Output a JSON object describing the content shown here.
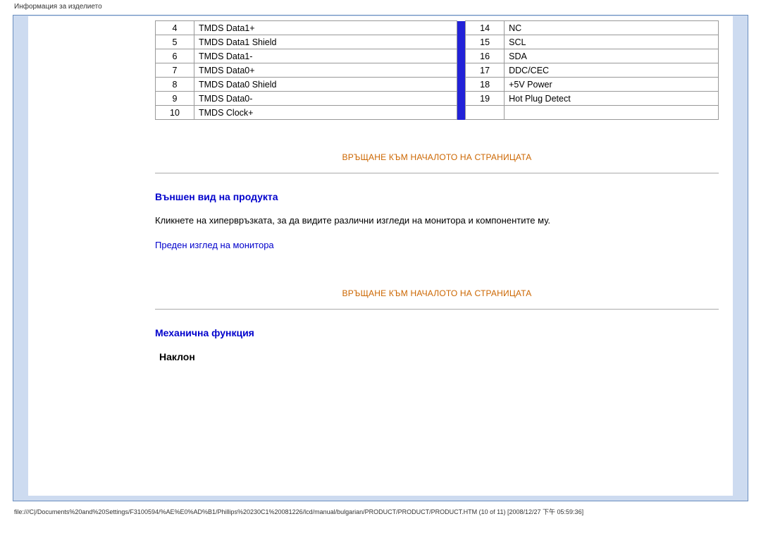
{
  "header": "Информация за изделието",
  "pin_left": [
    {
      "n": "4",
      "d": "TMDS Data1+"
    },
    {
      "n": "5",
      "d": "TMDS Data1 Shield"
    },
    {
      "n": "6",
      "d": "TMDS Data1-"
    },
    {
      "n": "7",
      "d": "TMDS Data0+"
    },
    {
      "n": "8",
      "d": "TMDS Data0 Shield"
    },
    {
      "n": "9",
      "d": "TMDS Data0-"
    },
    {
      "n": "10",
      "d": "TMDS Clock+"
    }
  ],
  "pin_right": [
    {
      "n": "14",
      "d": "NC"
    },
    {
      "n": "15",
      "d": "SCL"
    },
    {
      "n": "16",
      "d": "SDA"
    },
    {
      "n": "17",
      "d": "DDC/CEC"
    },
    {
      "n": "18",
      "d": "+5V Power"
    },
    {
      "n": "19",
      "d": "Hot Plug Detect"
    }
  ],
  "back_to_top": "ВРЪЩАНЕ КЪМ НАЧАЛОТО НА СТРАНИЦАТА",
  "section_appearance": "Външен вид на продукта",
  "appearance_text": "Кликнете на хипервръзката, за да видите различни изгледи на монитора и компонентите му.",
  "front_view_link": "Преден изглед на монитора",
  "section_mechanical": "Механична функция",
  "tilt_label": "Наклон",
  "footer": "file:///C|/Documents%20and%20Settings/F3100594/%AE%E0%AD%B1/Phillips%20230C1%20081226/lcd/manual/bulgarian/PRODUCT/PRODUCT/PRODUCT.HTM (10 of 11) [2008/12/27 下午 05:59:36]"
}
